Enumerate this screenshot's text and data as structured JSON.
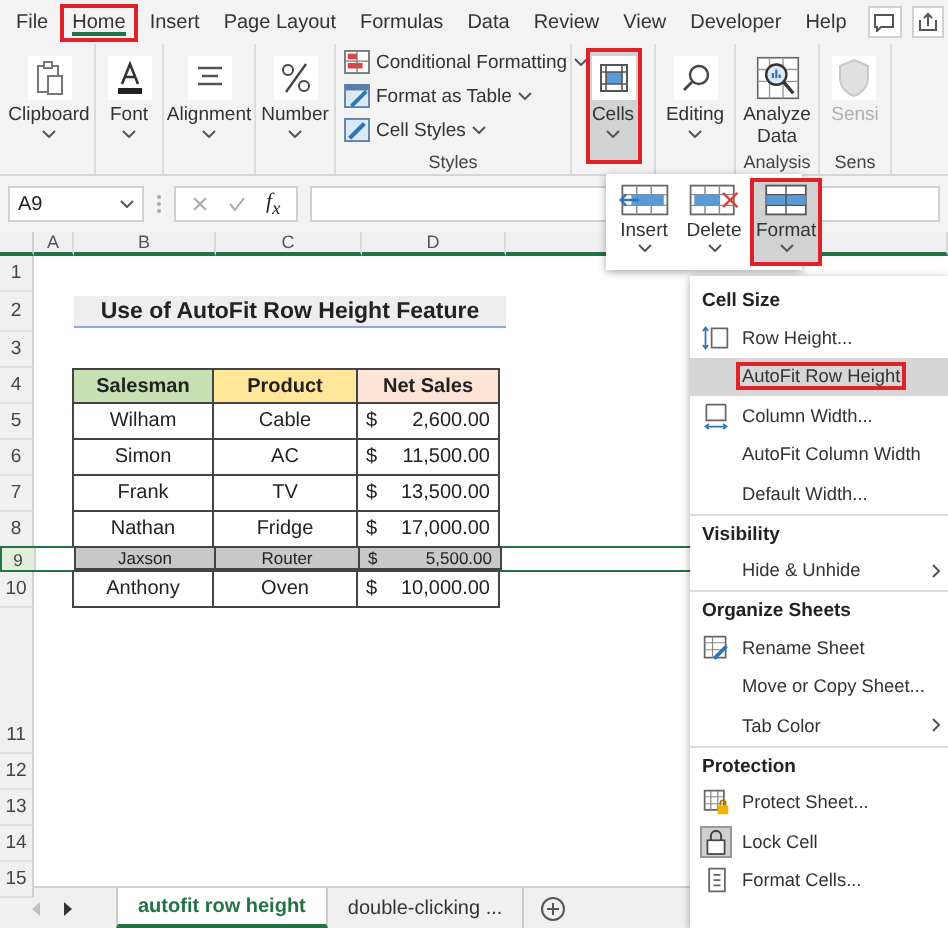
{
  "menu_tabs": [
    {
      "label": "File",
      "selected": false,
      "annotated": false
    },
    {
      "label": "Home",
      "selected": true,
      "annotated": true
    },
    {
      "label": "Insert",
      "selected": false,
      "annotated": false
    },
    {
      "label": "Page Layout",
      "selected": false,
      "annotated": false
    },
    {
      "label": "Formulas",
      "selected": false,
      "annotated": false
    },
    {
      "label": "Data",
      "selected": false,
      "annotated": false
    },
    {
      "label": "Review",
      "selected": false,
      "annotated": false
    },
    {
      "label": "View",
      "selected": false,
      "annotated": false
    },
    {
      "label": "Developer",
      "selected": false,
      "annotated": false
    },
    {
      "label": "Help",
      "selected": false,
      "annotated": false
    }
  ],
  "ribbon": [
    {
      "kind": "big",
      "label": "Clipboard",
      "annotated": false,
      "disabled": false
    },
    {
      "kind": "big",
      "label": "Font",
      "annotated": false,
      "disabled": false
    },
    {
      "kind": "big",
      "label": "Alignment",
      "annotated": false,
      "disabled": false
    },
    {
      "kind": "big",
      "label": "Number",
      "annotated": false,
      "disabled": false
    },
    {
      "kind": "list",
      "group_label": "Styles",
      "items": [
        {
          "label": "Conditional Formatting"
        },
        {
          "label": "Format as Table"
        },
        {
          "label": "Cell Styles"
        }
      ]
    },
    {
      "kind": "big",
      "label": "Cells",
      "annotated": true,
      "disabled": false
    },
    {
      "kind": "big",
      "label": "Editing",
      "annotated": false,
      "disabled": false
    },
    {
      "kind": "big",
      "label": "Analyze Data",
      "group_label": "Analysis",
      "annotated": false,
      "disabled": false
    },
    {
      "kind": "big",
      "label": "Sensi",
      "group_label": "Sens",
      "annotated": false,
      "disabled": true
    }
  ],
  "formula_bar": {
    "name_box": "A9",
    "fx": "f$_{x}$"
  },
  "columns": [
    "A",
    "B",
    "C",
    "D"
  ],
  "sheet": {
    "title": "Use of AutoFit Row Height Feature",
    "headers": [
      {
        "label": "Salesman",
        "color": "#c6e0b4"
      },
      {
        "label": "Product",
        "color": "#ffe699"
      },
      {
        "label": "Net Sales",
        "color": "#fce4d6"
      }
    ],
    "rows": [
      {
        "number": "5",
        "salesman": "Wilham",
        "product": "Cable",
        "currency": "$",
        "net_sales": "2,600.00",
        "selected": false
      },
      {
        "number": "6",
        "salesman": "Simon",
        "product": "AC",
        "currency": "$",
        "net_sales": "11,500.00",
        "selected": false
      },
      {
        "number": "7",
        "salesman": "Frank",
        "product": "TV",
        "currency": "$",
        "net_sales": "13,500.00",
        "selected": false
      },
      {
        "number": "8",
        "salesman": "Nathan",
        "product": "Fridge",
        "currency": "$",
        "net_sales": "17,000.00",
        "selected": false
      },
      {
        "number": "9",
        "salesman": "Jaxson",
        "product": "Router",
        "currency": "$",
        "net_sales": "5,500.00",
        "selected": true
      },
      {
        "number": "10",
        "salesman": "Anthony",
        "product": "Oven",
        "currency": "$",
        "net_sales": "10,000.00",
        "selected": false
      }
    ],
    "top_row_numbers": [
      "1",
      "2",
      "3",
      "4"
    ],
    "bottom_row_numbers": [
      "11",
      "12",
      "13",
      "14",
      "15"
    ]
  },
  "cells_dropdown": [
    {
      "label": "Insert",
      "selected": false
    },
    {
      "label": "Delete",
      "selected": false
    },
    {
      "label": "Format",
      "selected": true
    }
  ],
  "format_menu": [
    {
      "kind": "heading",
      "label": "Cell Size"
    },
    {
      "kind": "item",
      "label": "Row Height...",
      "highlighted": false,
      "submenu": false,
      "checked": false
    },
    {
      "kind": "item",
      "label": "AutoFit Row Height",
      "highlighted": true,
      "submenu": false,
      "checked": false
    },
    {
      "kind": "item",
      "label": "Column Width...",
      "highlighted": false,
      "submenu": false,
      "checked": false
    },
    {
      "kind": "item",
      "label": "AutoFit Column Width",
      "highlighted": false,
      "submenu": false,
      "checked": false
    },
    {
      "kind": "item",
      "label": "Default Width...",
      "highlighted": false,
      "submenu": false,
      "checked": false
    },
    {
      "kind": "heading",
      "label": "Visibility"
    },
    {
      "kind": "item",
      "label": "Hide & Unhide",
      "highlighted": false,
      "submenu": true,
      "checked": false
    },
    {
      "kind": "heading",
      "label": "Organize Sheets"
    },
    {
      "kind": "item",
      "label": "Rename Sheet",
      "highlighted": false,
      "submenu": false,
      "checked": false
    },
    {
      "kind": "item",
      "label": "Move or Copy Sheet...",
      "highlighted": false,
      "submenu": false,
      "checked": false
    },
    {
      "kind": "item",
      "label": "Tab Color",
      "highlighted": false,
      "submenu": true,
      "checked": false
    },
    {
      "kind": "heading",
      "label": "Protection"
    },
    {
      "kind": "item",
      "label": "Protect Sheet...",
      "highlighted": false,
      "submenu": false,
      "checked": false
    },
    {
      "kind": "item",
      "label": "Lock Cell",
      "highlighted": false,
      "submenu": false,
      "checked": true
    },
    {
      "kind": "item",
      "label": "Format Cells...",
      "highlighted": false,
      "submenu": false,
      "checked": false
    }
  ],
  "sheet_tabs": [
    {
      "label": "autofit row height",
      "selected": true
    },
    {
      "label": "double-clicking ...",
      "selected": false
    }
  ]
}
